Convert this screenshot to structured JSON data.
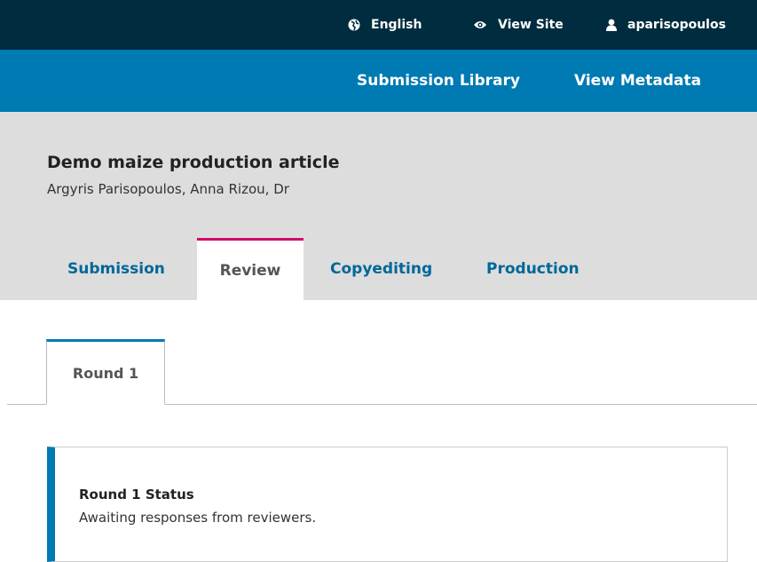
{
  "topbar": {
    "language_label": "English",
    "view_site_label": "View Site",
    "user_label": "aparisopoulos",
    "bg_color": "#002c3f"
  },
  "nav": {
    "library_label": "Submission Library",
    "metadata_label": "View Metadata",
    "bg_color": "#007ab2"
  },
  "submission": {
    "title": "Demo maize production article",
    "authors": "Argyris Parisopoulos, Anna Rizou, Dr"
  },
  "stage_tabs": [
    {
      "label": "Submission",
      "active": false
    },
    {
      "label": "Review",
      "active": true
    },
    {
      "label": "Copyediting",
      "active": false
    },
    {
      "label": "Production",
      "active": false
    }
  ],
  "rounds": [
    {
      "label": "Round 1",
      "active": true
    }
  ],
  "status": {
    "title": "Round 1 Status",
    "text": "Awaiting responses from reviewers."
  },
  "icons": {
    "language": "globe-icon",
    "view_site": "eye-icon",
    "user": "user-icon"
  },
  "colors": {
    "accent": "#007ab2",
    "active_tab_border": "#d00a6c",
    "header_bg": "#dddddd"
  }
}
